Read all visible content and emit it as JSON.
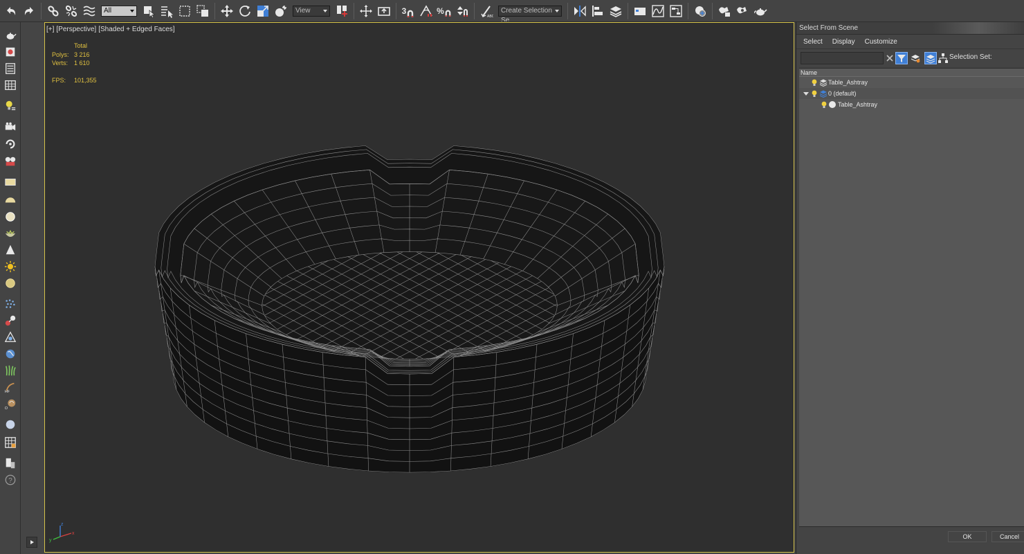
{
  "toolbar": {
    "selection_filter": "All",
    "reference_coord": "View",
    "named_selection_placeholder": "Create Selection Se",
    "snap_3d_label": "3",
    "percent_snap_label": "%"
  },
  "viewport": {
    "label_plus": "[+]",
    "label_view": "[Perspective]",
    "label_shading": "[Shaded + Edged Faces]",
    "stats": {
      "total_label": "Total",
      "polys_label": "Polys:",
      "polys_value": "3 216",
      "verts_label": "Verts:",
      "verts_value": "1 610",
      "fps_label": "FPS:",
      "fps_value": "101,355"
    },
    "axis": {
      "x": "x",
      "y": "y",
      "z": "z"
    }
  },
  "dialog": {
    "title": "Select From Scene",
    "menu": [
      "Select",
      "Display",
      "Customize"
    ],
    "filter_value": "",
    "selection_set_label": "Selection Set:",
    "column_name": "Name",
    "rows": [
      {
        "label": "Table_Ashtray",
        "kind": "layer-stack"
      },
      {
        "label": "0 (default)",
        "kind": "layer"
      },
      {
        "label": "Table_Ashtray",
        "kind": "object"
      }
    ],
    "ok_label": "OK",
    "cancel_label": "Cancel"
  },
  "colors": {
    "accent_blue": "#3f7fd6",
    "stat_yellow": "#e0c040",
    "viewport_border": "#d6c34a"
  }
}
